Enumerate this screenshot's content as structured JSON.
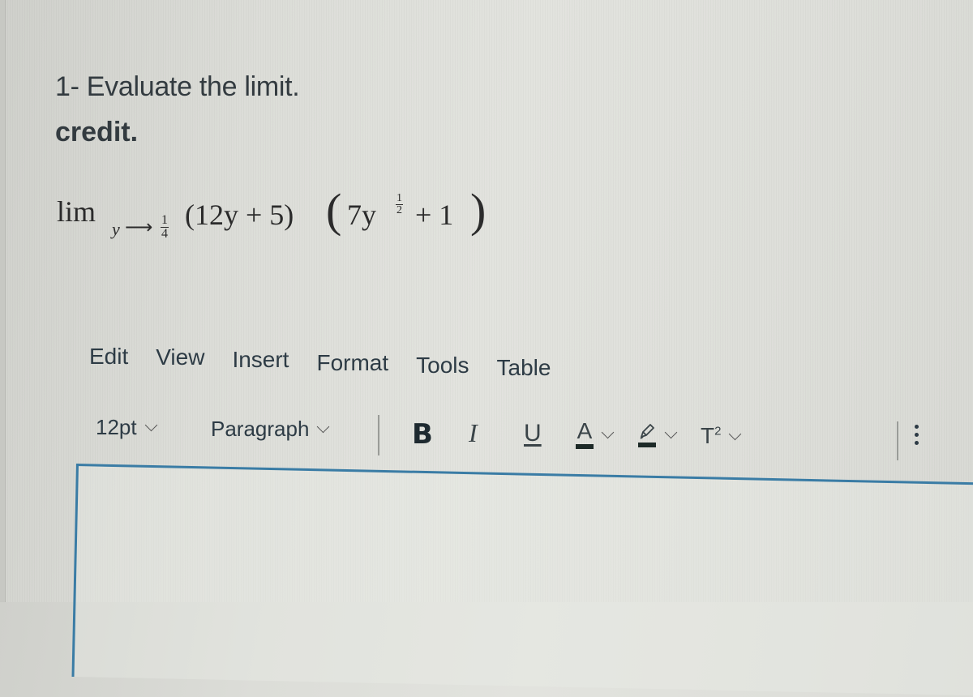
{
  "question": {
    "title": "1- Evaluate the limit.",
    "credit": "credit.",
    "math": {
      "operator": "lim",
      "variable": "y",
      "arrow": "⟶",
      "approach_numerator": "1",
      "approach_denominator": "4",
      "factor1": "(12y + 5)",
      "paren_left": "(",
      "paren_right": ")",
      "factor2_base": "7y",
      "exponent_numerator": "1",
      "exponent_denominator": "2",
      "factor2_tail": "+ 1"
    }
  },
  "editor": {
    "menu": [
      "Edit",
      "View",
      "Insert",
      "Format",
      "Tools",
      "Table"
    ],
    "toolbar": {
      "font_size": "12pt",
      "block_format": "Paragraph",
      "bold": "B",
      "italic": "I",
      "underline": "U",
      "text_color": "A",
      "superscript_base": "T",
      "superscript_exp": "2"
    },
    "content": "",
    "accent_color": "#3a7ca5"
  }
}
